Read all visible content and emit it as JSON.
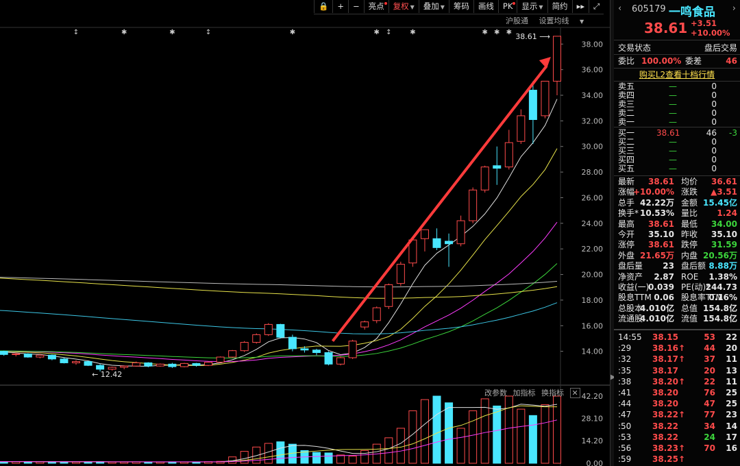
{
  "toolbar": {
    "items": [
      {
        "label": "亮点",
        "dot": true
      },
      {
        "label": "复权",
        "caret": true,
        "active": true
      },
      {
        "label": "叠加",
        "caret": true
      },
      {
        "label": "筹码"
      },
      {
        "label": "画线"
      },
      {
        "label": "PK",
        "dot": true
      },
      {
        "label": "显示",
        "caret": true
      },
      {
        "label": "简约"
      }
    ],
    "sublinks": [
      "沪股通",
      "设置均线"
    ]
  },
  "chart": {
    "y_ticks": [
      "38.00",
      "36.00",
      "34.00",
      "32.00",
      "30.00",
      "28.00",
      "26.00",
      "24.00",
      "22.00",
      "20.00",
      "18.00",
      "16.00",
      "14.00"
    ],
    "high_label": "38.61",
    "low_label": "12.42",
    "vol_ticks": [
      "42.20",
      "28.10",
      "14.20",
      "0.00"
    ],
    "vol_tools": [
      "改参数",
      "加指标",
      "换指标"
    ]
  },
  "chart_data": {
    "type": "candlestick",
    "y_range": [
      12.0,
      39.3
    ],
    "candles": [
      [
        13.9,
        14.05,
        13.7,
        13.85
      ],
      [
        13.85,
        14.1,
        13.75,
        14.0
      ],
      [
        14.0,
        14.05,
        13.65,
        13.75
      ],
      [
        13.75,
        13.9,
        13.6,
        13.8
      ],
      [
        13.8,
        13.85,
        13.5,
        13.55
      ],
      [
        13.55,
        13.8,
        13.45,
        13.7
      ],
      [
        13.7,
        13.75,
        13.3,
        13.4
      ],
      [
        13.4,
        13.5,
        13.05,
        13.1
      ],
      [
        13.1,
        13.3,
        12.95,
        13.2
      ],
      [
        13.2,
        13.25,
        12.85,
        12.9
      ],
      [
        12.9,
        13.0,
        12.42,
        12.6
      ],
      [
        12.6,
        12.8,
        12.5,
        12.75
      ],
      [
        12.75,
        12.9,
        12.6,
        12.85
      ],
      [
        12.85,
        13.2,
        12.8,
        13.1
      ],
      [
        13.1,
        13.15,
        12.75,
        12.85
      ],
      [
        12.85,
        13.05,
        12.8,
        13.0
      ],
      [
        13.0,
        13.1,
        12.7,
        12.8
      ],
      [
        12.8,
        13.1,
        12.75,
        13.05
      ],
      [
        13.05,
        13.1,
        12.8,
        12.9
      ],
      [
        12.9,
        13.2,
        12.85,
        13.15
      ],
      [
        13.15,
        13.6,
        13.1,
        13.55
      ],
      [
        13.55,
        14.1,
        13.5,
        14.05
      ],
      [
        14.05,
        14.8,
        13.95,
        14.7
      ],
      [
        14.7,
        15.4,
        14.6,
        15.3
      ],
      [
        15.3,
        16.2,
        15.2,
        16.1
      ],
      [
        16.1,
        16.15,
        15.0,
        15.1
      ],
      [
        15.1,
        15.3,
        14.0,
        14.2
      ],
      [
        14.2,
        14.4,
        13.9,
        14.1
      ],
      [
        14.1,
        14.2,
        13.7,
        13.9
      ],
      [
        13.9,
        14.0,
        12.9,
        13.0
      ],
      [
        13.0,
        13.6,
        12.9,
        13.5
      ],
      [
        13.5,
        14.9,
        13.4,
        14.8
      ],
      [
        15.9,
        16.4,
        15.7,
        16.3
      ],
      [
        16.4,
        17.5,
        16.2,
        17.4
      ],
      [
        17.5,
        19.3,
        17.3,
        19.2
      ],
      [
        19.3,
        21.0,
        19.1,
        20.8
      ],
      [
        20.9,
        22.9,
        20.6,
        22.7
      ],
      [
        22.8,
        23.4,
        21.8,
        23.5
      ],
      [
        22.8,
        23.6,
        21.9,
        22.1
      ],
      [
        22.6,
        23.2,
        20.6,
        22.4
      ],
      [
        22.4,
        24.6,
        22.2,
        24.2
      ],
      [
        24.2,
        26.8,
        24.0,
        26.6
      ],
      [
        26.6,
        28.5,
        26.4,
        28.4
      ],
      [
        28.5,
        30.0,
        27.0,
        28.3
      ],
      [
        28.4,
        31.3,
        28.2,
        30.3
      ],
      [
        30.4,
        32.9,
        30.2,
        32.4
      ],
      [
        34.4,
        35.1,
        30.2,
        32.1
      ],
      [
        32.4,
        35.1,
        32.2,
        35.1
      ],
      [
        35.1,
        38.61,
        34.0,
        38.61
      ]
    ],
    "volume_max": 42.2,
    "volume": [
      1.0,
      1.0,
      1.0,
      1.0,
      1.0,
      0.9,
      1.0,
      0.9,
      0.8,
      0.9,
      1.0,
      0.8,
      0.8,
      0.9,
      0.8,
      0.8,
      0.9,
      0.8,
      0.8,
      1.0,
      1.2,
      4.0,
      7.5,
      10.2,
      12.5,
      13.5,
      12.0,
      8.0,
      6.8,
      6.5,
      5.2,
      4.5,
      8.0,
      12.0,
      16.0,
      22.0,
      33.0,
      40.0,
      42.2,
      38.0,
      22.0,
      33.0,
      40.5,
      36.0,
      42.2,
      34.0,
      30.0,
      36.8,
      42.2,
      34.0,
      42.2
    ],
    "ma_colors": [
      "#e0e0e0",
      "#e8e34a",
      "#ff3cff",
      "#3cd53c",
      "#3cc7e6"
    ]
  },
  "header": {
    "code": "605179",
    "name": "一鸣食品",
    "price": "38.61",
    "change": "+3.51",
    "pct": "+10.00%"
  },
  "status": {
    "label": "交易状态",
    "value": "盘后交易",
    "weibi_label": "委比",
    "weibi": "100.00%",
    "weicha_label": "委差",
    "weicha": "46",
    "l2": "购买L2查看十档行情"
  },
  "book": {
    "sells": [
      {
        "label": "卖五",
        "price": "—",
        "vol": "0"
      },
      {
        "label": "卖四",
        "price": "—",
        "vol": "0"
      },
      {
        "label": "卖三",
        "price": "—",
        "vol": "0"
      },
      {
        "label": "卖二",
        "price": "—",
        "vol": "0"
      },
      {
        "label": "卖一",
        "price": "—",
        "vol": "0"
      }
    ],
    "buys": [
      {
        "label": "买一",
        "price": "38.61",
        "vol": "46",
        "diff": "-3"
      },
      {
        "label": "买二",
        "price": "—",
        "vol": "0",
        "diff": ""
      },
      {
        "label": "买三",
        "price": "—",
        "vol": "0",
        "diff": ""
      },
      {
        "label": "买四",
        "price": "—",
        "vol": "0",
        "diff": ""
      },
      {
        "label": "买五",
        "price": "—",
        "vol": "0",
        "diff": ""
      }
    ]
  },
  "stats": [
    {
      "k1": "最新",
      "v1": "38.61",
      "c1": "red",
      "k2": "均价",
      "v2": "36.61",
      "c2": "red"
    },
    {
      "k1": "涨幅",
      "v1": "+10.00%",
      "c1": "red",
      "k2": "涨跌",
      "v2": "▲3.51",
      "c2": "red"
    },
    {
      "k1": "总手",
      "v1": "42.22万",
      "c1": "white",
      "k2": "金额",
      "v2": "15.45亿",
      "c2": "cyan"
    },
    {
      "k1": "换手*",
      "v1": "10.53%",
      "c1": "white",
      "k2": "量比",
      "v2": "1.24",
      "c2": "red"
    },
    {
      "k1": "最高",
      "v1": "38.61",
      "c1": "red",
      "k2": "最低",
      "v2": "34.00",
      "c2": "green"
    },
    {
      "k1": "今开",
      "v1": "35.10",
      "c1": "white",
      "k2": "昨收",
      "v2": "35.10",
      "c2": "white"
    },
    {
      "k1": "涨停",
      "v1": "38.61",
      "c1": "red",
      "k2": "跌停",
      "v2": "31.59",
      "c2": "green"
    },
    {
      "k1": "外盘",
      "v1": "21.65万",
      "c1": "red",
      "k2": "内盘",
      "v2": "20.56万",
      "c2": "green"
    },
    {
      "k1": "盘后量",
      "v1": "23",
      "c1": "white",
      "k2": "盘后额",
      "v2": "8.88万",
      "c2": "cyan"
    },
    {
      "k1": "净资产",
      "v1": "2.87",
      "c1": "white",
      "k2": "ROE",
      "v2": "1.38%",
      "c2": "white"
    },
    {
      "k1": "收益(一)",
      "v1": "0.039",
      "c1": "white",
      "k2": "PE(动)*",
      "v2": "244.73",
      "c2": "white"
    },
    {
      "k1": "股息TTM",
      "v1": "0.06",
      "c1": "white",
      "k2": "股息率TTM",
      "v2": "0.16%",
      "c2": "white"
    },
    {
      "k1": "总股本",
      "v1": "4.010亿",
      "c1": "white",
      "k2": "总值",
      "v2": "154.8亿",
      "c2": "white"
    },
    {
      "k1": "流通股",
      "v1": "4.010亿",
      "c1": "white",
      "k2": "流值",
      "v2": "154.8亿",
      "c2": "white"
    }
  ],
  "ticks": [
    {
      "t": "14:55",
      "p": "38.15",
      "arrow": "",
      "v": "53",
      "n": "22"
    },
    {
      "t": ":29",
      "p": "38.16",
      "arrow": "↑",
      "v": "44",
      "n": "20"
    },
    {
      "t": ":32",
      "p": "38.17",
      "arrow": "↑",
      "v": "37",
      "n": "11"
    },
    {
      "t": ":35",
      "p": "38.17",
      "arrow": "",
      "v": "20",
      "n": "13"
    },
    {
      "t": ":38",
      "p": "38.20",
      "arrow": "↑",
      "v": "22",
      "n": "11"
    },
    {
      "t": ":41",
      "p": "38.20",
      "arrow": "",
      "v": "76",
      "n": "25"
    },
    {
      "t": ":44",
      "p": "38.20",
      "arrow": "",
      "v": "47",
      "n": "25"
    },
    {
      "t": ":47",
      "p": "38.22",
      "arrow": "↑",
      "v": "77",
      "n": "23"
    },
    {
      "t": ":50",
      "p": "38.22",
      "arrow": "",
      "v": "34",
      "n": "14"
    },
    {
      "t": ":53",
      "p": "38.22",
      "arrow": "",
      "v": "24",
      "n": "17",
      "vc": "green"
    },
    {
      "t": ":56",
      "p": "38.23",
      "arrow": "↑",
      "v": "70",
      "n": "16"
    },
    {
      "t": ":59",
      "p": "38.25",
      "arrow": "↑",
      "v": "",
      "n": ""
    }
  ]
}
